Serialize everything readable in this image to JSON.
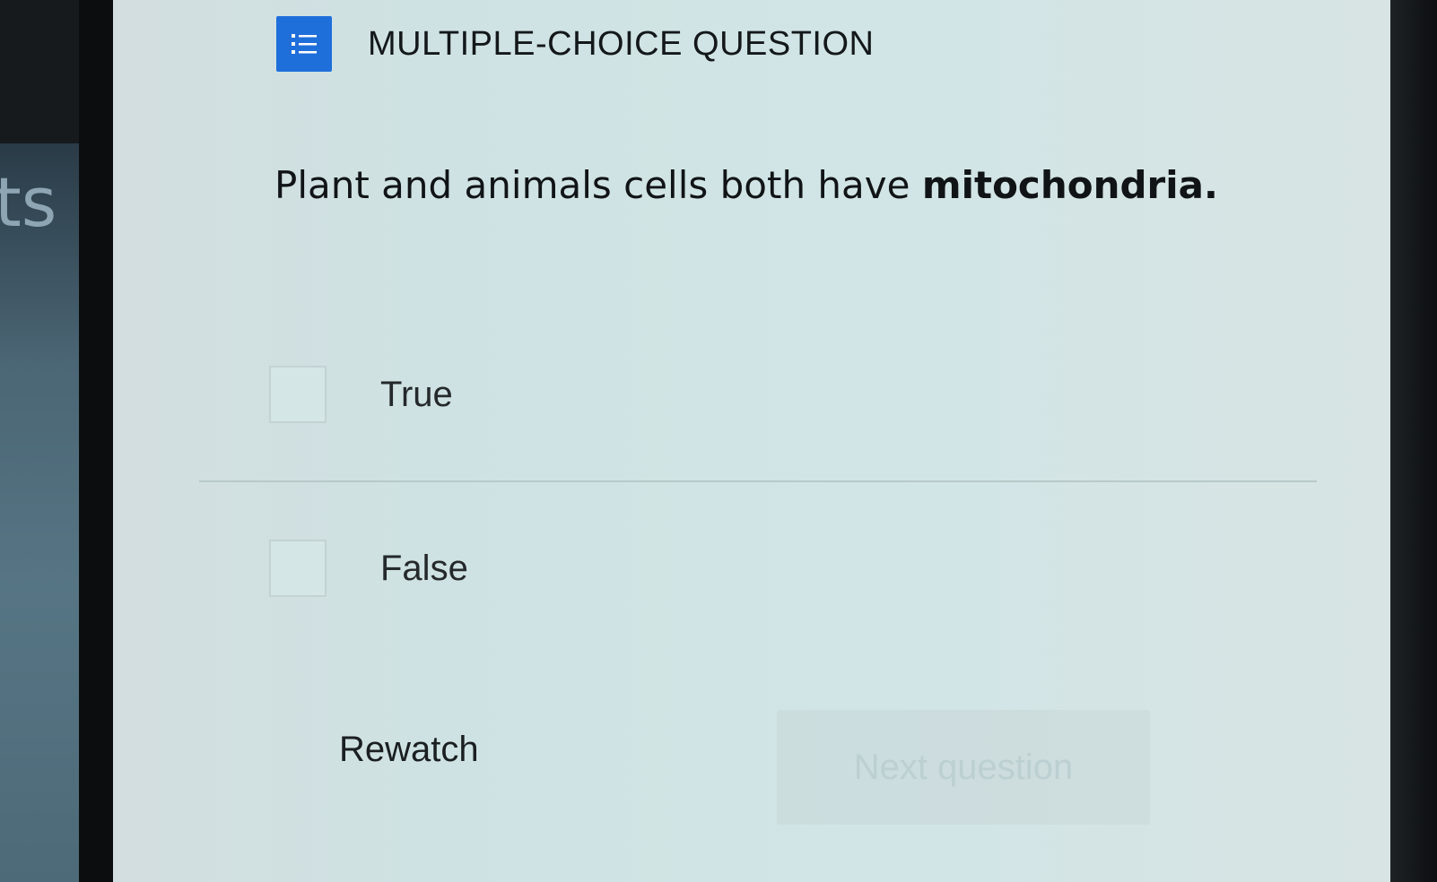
{
  "background_tab": {
    "partial_text": "ts"
  },
  "question_card": {
    "icon": "list-icon",
    "type_label": "MULTIPLE-CHOICE QUESTION",
    "question_text": "Plant and animals cells both have ",
    "question_emphasis": "mitochondria.",
    "options": [
      {
        "label": "True",
        "checked": false
      },
      {
        "label": "False",
        "checked": false
      }
    ],
    "rewatch_label": "Rewatch",
    "next_label": "Next question",
    "next_enabled": false
  },
  "colors": {
    "accent": "#1f6fdb",
    "card_background": "#d1e5e6"
  }
}
